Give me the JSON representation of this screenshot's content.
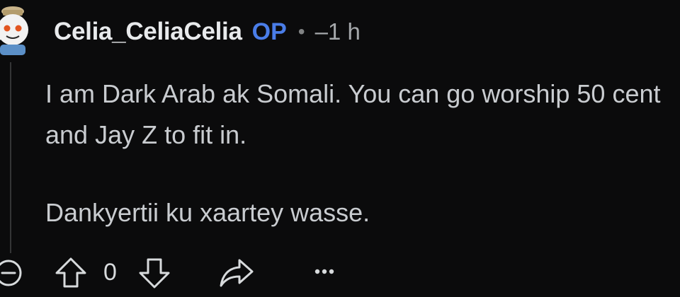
{
  "comment": {
    "author": "Celia_CeliaCelia",
    "op_badge": "OP",
    "separator": "•",
    "time": "–1 h",
    "avatar_icon": "snoo-avatar-icon",
    "paragraphs": [
      "I am Dark Arab ak Somali. You can go worship 50 cent and Jay Z to fit in.",
      "Dankyertii ku xaartey wasse."
    ],
    "score": "0"
  },
  "actions": {
    "collapse_icon": "minus-circle-icon",
    "upvote_icon": "arrow-up-icon",
    "downvote_icon": "arrow-down-icon",
    "share_icon": "share-arrow-icon",
    "more_icon": "ellipsis-icon"
  },
  "colors": {
    "background": "#0b0b0c",
    "op_badge": "#4a7de8",
    "text": "#d7dadc",
    "muted": "#818384"
  }
}
